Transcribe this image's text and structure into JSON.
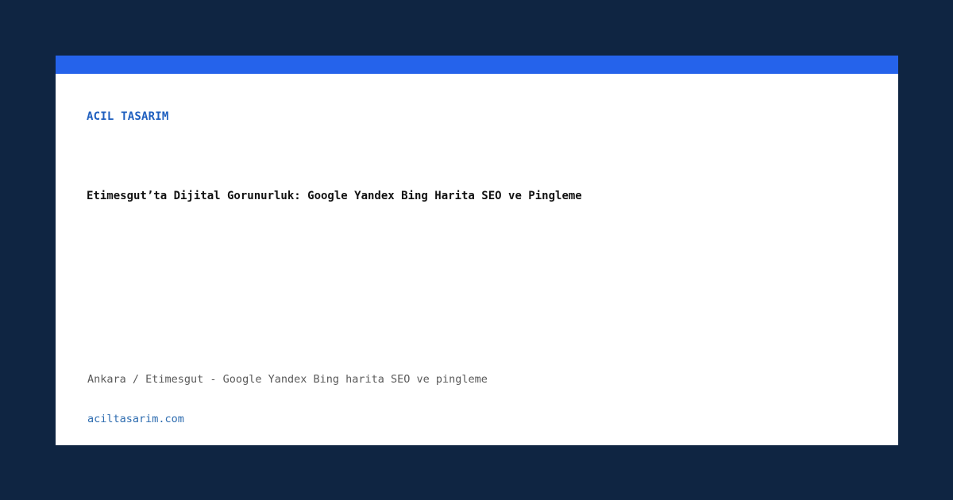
{
  "brand": {
    "name": "ACIL TASARIM"
  },
  "article": {
    "title": "Etimesgut’ta Dijital Gorunurluk: Google Yandex Bing Harita SEO ve Pingleme",
    "subtitle": "Ankara / Etimesgut - Google Yandex Bing harita SEO ve pingleme"
  },
  "footer": {
    "domain": "aciltasarim.com"
  },
  "colors": {
    "background": "#0f2542",
    "card": "#ffffff",
    "accent_bar": "#2563eb",
    "brand_text": "#1f5fbf",
    "domain_text": "#2f6db0"
  }
}
